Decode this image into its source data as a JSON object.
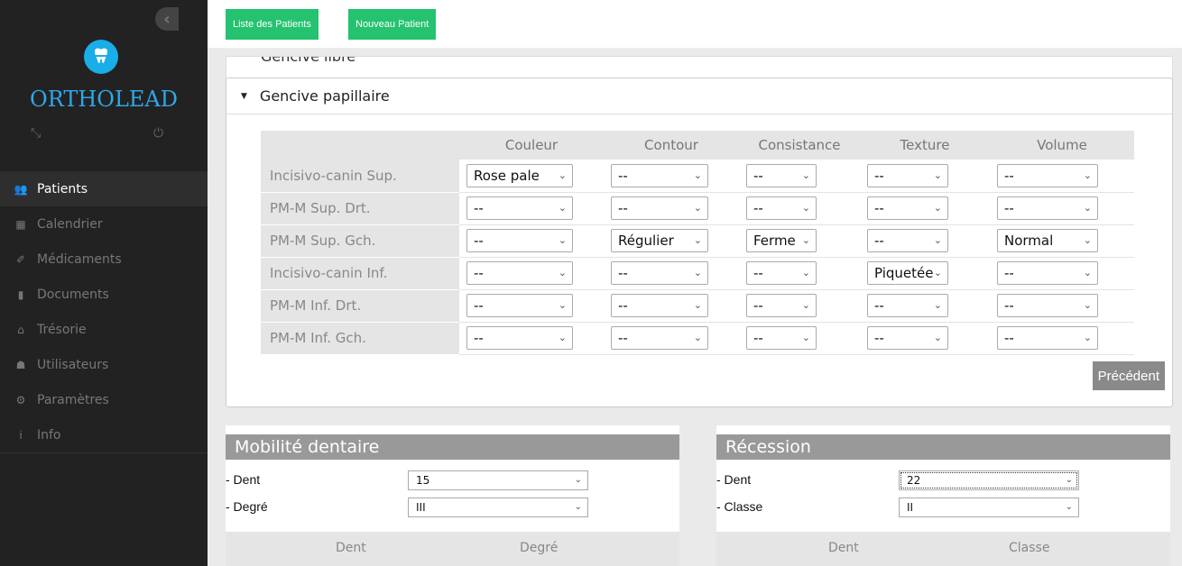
{
  "brand": "ORTHOLEAD",
  "topbar": {
    "list_label": "Liste des Patients",
    "new_label": "Nouveau Patient"
  },
  "menu": [
    {
      "label": "Patients",
      "icon": "patients-icon",
      "active": true
    },
    {
      "label": "Calendrier",
      "icon": "calendar-icon"
    },
    {
      "label": "Médicaments",
      "icon": "pill-icon"
    },
    {
      "label": "Documents",
      "icon": "document-icon"
    },
    {
      "label": "Trésorie",
      "icon": "treasury-icon"
    },
    {
      "label": "Utilisateurs",
      "icon": "users-icon"
    },
    {
      "label": "Paramètres",
      "icon": "settings-icon"
    },
    {
      "label": "Info",
      "icon": "info-icon"
    }
  ],
  "collapsed_panel_title": "Gencive libre",
  "panel": {
    "title": "Gencive papillaire",
    "columns": [
      "Couleur",
      "Contour",
      "Consistance",
      "Texture",
      "Volume"
    ],
    "rows": [
      {
        "label": "Incisivo-canin Sup.",
        "values": [
          "Rose pale",
          "--",
          "--",
          "--",
          "--"
        ]
      },
      {
        "label": "PM-M Sup. Drt.",
        "values": [
          "--",
          "--",
          "--",
          "--",
          "--"
        ]
      },
      {
        "label": "PM-M Sup. Gch.",
        "values": [
          "--",
          "Régulier",
          "Ferme",
          "--",
          "Normal"
        ]
      },
      {
        "label": "Incisivo-canin Inf.",
        "values": [
          "--",
          "--",
          "--",
          "Piquetée",
          "--"
        ]
      },
      {
        "label": "PM-M Inf. Drt.",
        "values": [
          "--",
          "--",
          "--",
          "--",
          "--"
        ]
      },
      {
        "label": "PM-M Inf. Gch.",
        "values": [
          "--",
          "--",
          "--",
          "--",
          "--"
        ]
      }
    ],
    "prev_label": "Précédent"
  },
  "mobility": {
    "title": "Mobilité dentaire",
    "dent_label": "- Dent",
    "dent_value": "15",
    "degree_label": "- Degré",
    "degree_value": "III",
    "col1": "Dent",
    "col2": "Degré"
  },
  "recession": {
    "title": "Récession",
    "dent_label": "- Dent",
    "dent_value": "22",
    "class_label": "- Classe",
    "class_value": "II",
    "col1": "Dent",
    "col2": "Classe"
  },
  "colors": {
    "accent_green": "#25c26f",
    "brand_blue": "#2ea8e8",
    "sidebar": "#222222"
  }
}
